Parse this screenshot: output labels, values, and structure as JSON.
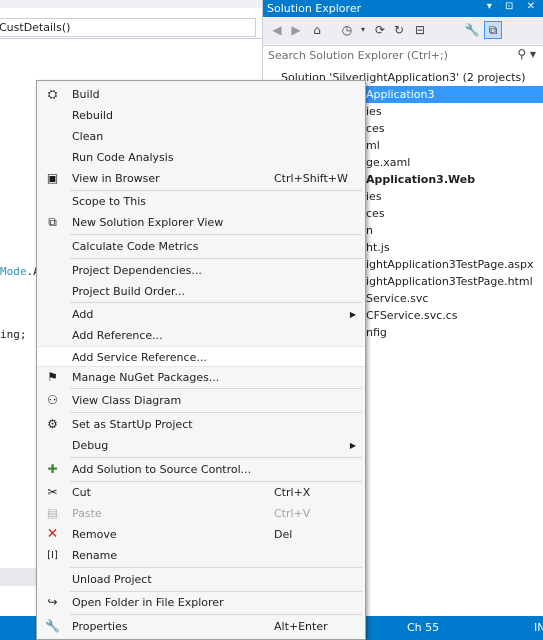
{
  "editor": {
    "nav_text": "CustDetails()",
    "code_lines": [
      {
        "type_text": "Mode",
        "rest_text": ".A"
      },
      {
        "text": "ing;"
      }
    ]
  },
  "solution_explorer": {
    "title": "Solution Explorer",
    "title_icons": "▾ ⊡ ✕",
    "search_placeholder": "Search Solution Explorer (Ctrl+;)",
    "toolbar_icons": [
      "back-icon",
      "forward-icon",
      "home-icon",
      "history-icon",
      "sync-icon",
      "refresh-icon",
      "collapse-icon",
      "properties-icon",
      "preview-icon"
    ],
    "tree": [
      {
        "label": "Solution 'SilverlightApplication3' (2 projects)"
      },
      {
        "label": "Application3"
      },
      {
        "label": "ies"
      },
      {
        "label": "ces"
      },
      {
        "label": "ml"
      },
      {
        "label": "ge.xaml"
      },
      {
        "label": "Application3.Web"
      },
      {
        "label": "ies"
      },
      {
        "label": "ces"
      },
      {
        "label": "n"
      },
      {
        "label": "ht.js"
      },
      {
        "label": "ightApplication3TestPage.aspx"
      },
      {
        "label": "ightApplication3TestPage.html"
      },
      {
        "label": "Service.svc"
      },
      {
        "label": "CFService.svc.cs"
      },
      {
        "label": "nfig"
      }
    ]
  },
  "status_bar": {
    "col_text": "Ch 55",
    "mode_text": "IN"
  },
  "context_menu": {
    "items": [
      {
        "label": "Build",
        "icon": "build-icon"
      },
      {
        "label": "Rebuild"
      },
      {
        "label": "Clean"
      },
      {
        "label": "Run Code Analysis"
      },
      {
        "label": "View in Browser",
        "shortcut": "Ctrl+Shift+W",
        "icon": "browser-icon"
      },
      {
        "label": "Scope to This"
      },
      {
        "label": "New Solution Explorer View",
        "icon": "new-view-icon"
      },
      {
        "label": "Calculate Code Metrics"
      },
      {
        "label": "Project Dependencies..."
      },
      {
        "label": "Project Build Order..."
      },
      {
        "label": "Add",
        "submenu": true
      },
      {
        "label": "Add Reference..."
      },
      {
        "label": "Add Service Reference...",
        "highlighted": true
      },
      {
        "label": "Manage NuGet Packages...",
        "icon": "nuget-icon"
      },
      {
        "label": "View Class Diagram",
        "icon": "class-diagram-icon"
      },
      {
        "label": "Set as StartUp Project",
        "icon": "gear-icon"
      },
      {
        "label": "Debug",
        "submenu": true
      },
      {
        "label": "Add Solution to Source Control...",
        "icon": "source-control-icon"
      },
      {
        "label": "Cut",
        "shortcut": "Ctrl+X",
        "icon": "scissors-icon"
      },
      {
        "label": "Paste",
        "shortcut": "Ctrl+V",
        "icon": "paste-icon",
        "disabled": true
      },
      {
        "label": "Remove",
        "shortcut": "Del",
        "icon": "remove-icon"
      },
      {
        "label": "Rename",
        "icon": "rename-icon"
      },
      {
        "label": "Unload Project"
      },
      {
        "label": "Open Folder in File Explorer",
        "icon": "open-folder-icon"
      },
      {
        "label": "Properties",
        "shortcut": "Alt+Enter",
        "icon": "wrench-icon"
      }
    ]
  },
  "colors": {
    "accent": "#007acc",
    "selection": "#3399ff",
    "remove_icon": "#c42b1c"
  }
}
